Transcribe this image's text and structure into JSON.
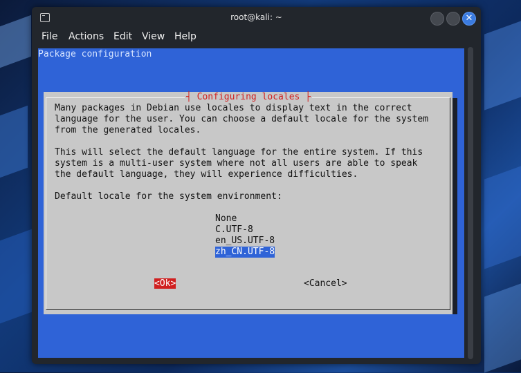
{
  "window": {
    "title": "root@kali: ~"
  },
  "menu": [
    "File",
    "Actions",
    "Edit",
    "View",
    "Help"
  ],
  "terminal": {
    "header": "Package configuration"
  },
  "dialog": {
    "title": "Configuring locales",
    "paragraph1": [
      "Many packages in Debian use locales to display text in the correct",
      "language for the user. You can choose a default locale for the system",
      "from the generated locales."
    ],
    "paragraph2": [
      "This will select the default language for the entire system. If this",
      "system is a multi-user system where not all users are able to speak",
      "the default language, they will experience difficulties."
    ],
    "prompt": "Default locale for the system environment:",
    "options": [
      "None",
      "C.UTF-8",
      "en_US.UTF-8",
      "zh_CN.UTF-8"
    ],
    "selected_option": "zh_CN.UTF-8",
    "ok_label": "<Ok>",
    "cancel_label": "<Cancel>"
  },
  "colors": {
    "terminal_bg": "#2f63d7",
    "dialog_bg": "#c8c8c8",
    "title_red": "#d02020",
    "selection": "#2f63d7"
  }
}
